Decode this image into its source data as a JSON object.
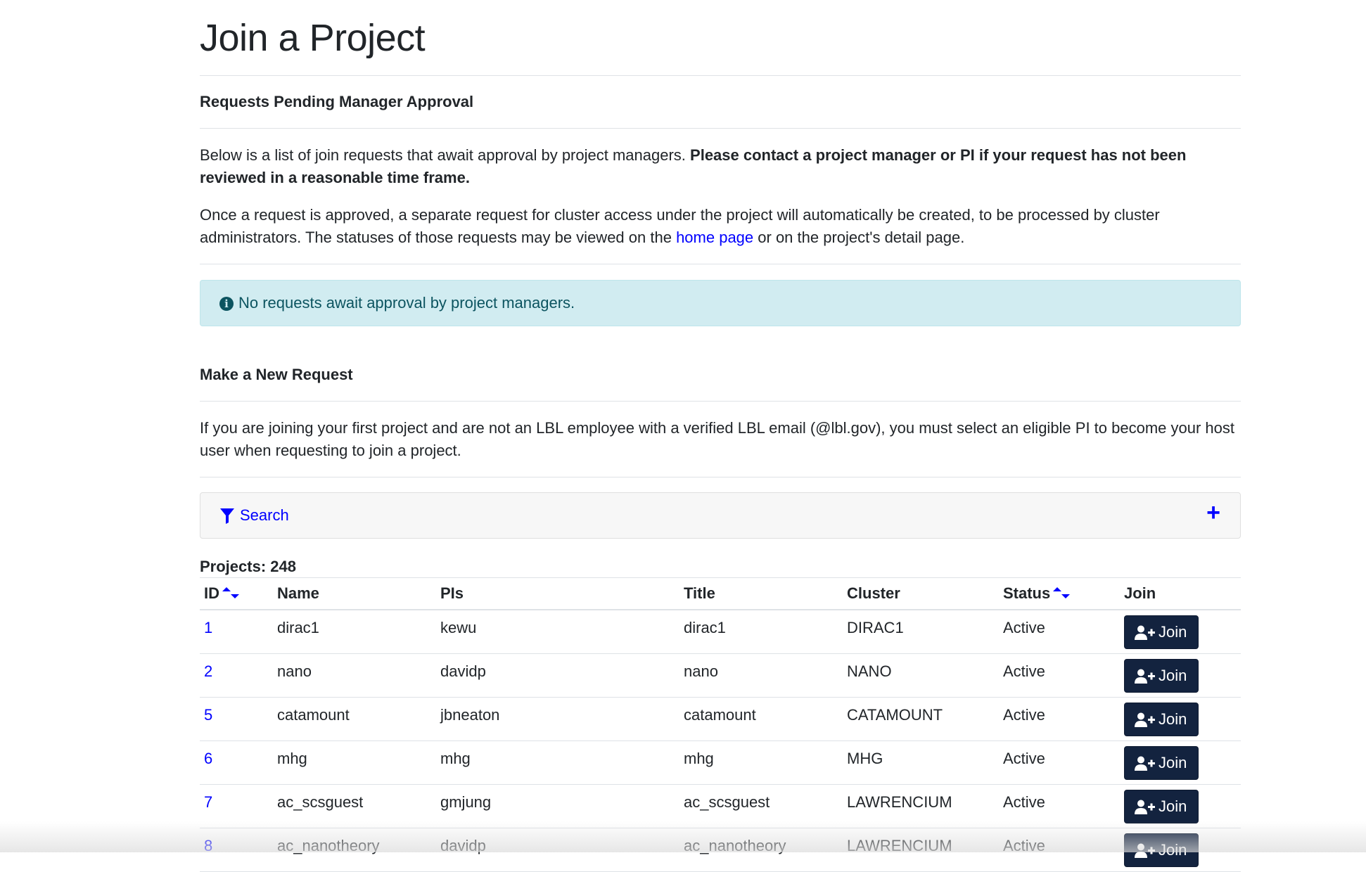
{
  "page": {
    "title": "Join a Project"
  },
  "pending": {
    "heading": "Requests Pending Manager Approval",
    "intro_text": "Below is a list of join requests that await approval by project managers. ",
    "intro_bold": "Please contact a project manager or PI if your request has not been reviewed in a reasonable time frame.",
    "approved_text_1": "Once a request is approved, a separate request for cluster access under the project will automatically be created, to be processed by cluster administrators. The statuses of those requests may be viewed on the ",
    "home_link": "home page",
    "approved_text_2": " or on the project's detail page.",
    "alert_icon": "info-circle-icon",
    "alert_text": "No requests await approval by project managers."
  },
  "new_request": {
    "heading": "Make a New Request",
    "description": "If you are joining your first project and are not an LBL employee with a verified LBL email (@lbl.gov), you must select an eligible PI to become your host user when requesting to join a project."
  },
  "search": {
    "label": "Search",
    "icon": "filter-icon",
    "expand_icon": "plus-icon"
  },
  "projects": {
    "count_label": "Projects: 248",
    "columns": {
      "id": "ID",
      "name": "Name",
      "pis": "PIs",
      "title": "Title",
      "cluster": "Cluster",
      "status": "Status",
      "join": "Join"
    },
    "join_button_label": "Join",
    "rows": [
      {
        "id": "1",
        "name": "dirac1",
        "pis": "kewu",
        "title": "dirac1",
        "cluster": "DIRAC1",
        "status": "Active"
      },
      {
        "id": "2",
        "name": "nano",
        "pis": "davidp",
        "title": "nano",
        "cluster": "NANO",
        "status": "Active"
      },
      {
        "id": "5",
        "name": "catamount",
        "pis": "jbneaton",
        "title": "catamount",
        "cluster": "CATAMOUNT",
        "status": "Active"
      },
      {
        "id": "6",
        "name": "mhg",
        "pis": "mhg",
        "title": "mhg",
        "cluster": "MHG",
        "status": "Active"
      },
      {
        "id": "7",
        "name": "ac_scsguest",
        "pis": "gmjung",
        "title": "ac_scsguest",
        "cluster": "LAWRENCIUM",
        "status": "Active"
      },
      {
        "id": "8",
        "name": "ac_nanotheory",
        "pis": "davidp",
        "title": "ac_nanotheory",
        "cluster": "LAWRENCIUM",
        "status": "Active"
      }
    ]
  },
  "colors": {
    "link": "#0000ff",
    "button_bg": "#13233f",
    "alert_bg": "#d1ecf1",
    "alert_text": "#0c5460"
  }
}
